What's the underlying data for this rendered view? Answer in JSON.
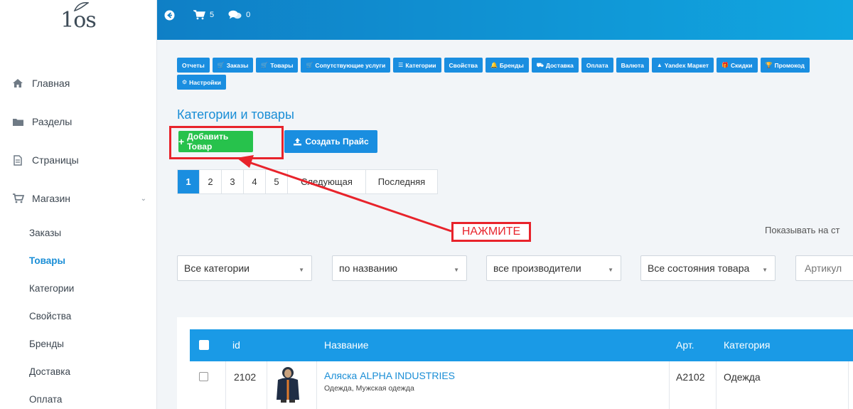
{
  "logo": {
    "text": "1os"
  },
  "sidebar": {
    "items": [
      {
        "label": "Главная",
        "icon": "home-icon"
      },
      {
        "label": "Разделы",
        "icon": "folder-icon"
      },
      {
        "label": "Страницы",
        "icon": "file-icon"
      },
      {
        "label": "Магазин",
        "icon": "cart-icon"
      }
    ],
    "submenu": [
      {
        "label": "Заказы"
      },
      {
        "label": "Товары",
        "active": true
      },
      {
        "label": "Категории"
      },
      {
        "label": "Свойства"
      },
      {
        "label": "Бренды"
      },
      {
        "label": "Доставка"
      },
      {
        "label": "Оплата"
      }
    ]
  },
  "topbar": {
    "cart_count": "5",
    "messages_count": "0"
  },
  "quickbar": {
    "row1": [
      {
        "label": "Отчеты",
        "icon": ""
      },
      {
        "label": "Заказы",
        "icon": "cart-icon"
      },
      {
        "label": "Товары",
        "icon": "cart-icon"
      },
      {
        "label": "Сопутствующие услуги",
        "icon": "cart-icon"
      },
      {
        "label": "Категории",
        "icon": "list-icon"
      },
      {
        "label": "Свойства",
        "icon": ""
      },
      {
        "label": "Бренды",
        "icon": "bell-icon"
      },
      {
        "label": "Доставка",
        "icon": "truck-icon"
      },
      {
        "label": "Оплата",
        "icon": ""
      },
      {
        "label": "Валюта",
        "icon": ""
      },
      {
        "label": "Yandex Маркет",
        "icon": "upload-icon"
      },
      {
        "label": "Скидки",
        "icon": "gift-icon"
      },
      {
        "label": "Промокод",
        "icon": "trophy-icon"
      }
    ],
    "row2": [
      {
        "label": "Настройки",
        "icon": "gear-icon"
      }
    ]
  },
  "page": {
    "title": "Категории и товары",
    "add_button": "Добавить Товар",
    "price_button": "Создать Прайс",
    "callout": "НАЖМИТЕ",
    "showing_label": "Показывать на ст"
  },
  "pagination": [
    "1",
    "2",
    "3",
    "4",
    "5",
    "Следующая",
    "Последняя"
  ],
  "filters": {
    "category": "Все категории",
    "sort": "по названию",
    "manufacturer": "все производители",
    "state": "Все состояния товара",
    "article_placeholder": "Артикул"
  },
  "table": {
    "headers": {
      "id": "id",
      "name": "Название",
      "art": "Арт.",
      "category": "Категория"
    },
    "rows": [
      {
        "id": "2102",
        "name": "Аляска ALPHA INDUSTRIES",
        "sub": "Одежда, Мужская одежда",
        "art": "A2102",
        "category": "Одежда"
      }
    ]
  },
  "colors": {
    "accent": "#1a8ee0",
    "green": "#27c24c",
    "highlight": "#e8232b"
  }
}
